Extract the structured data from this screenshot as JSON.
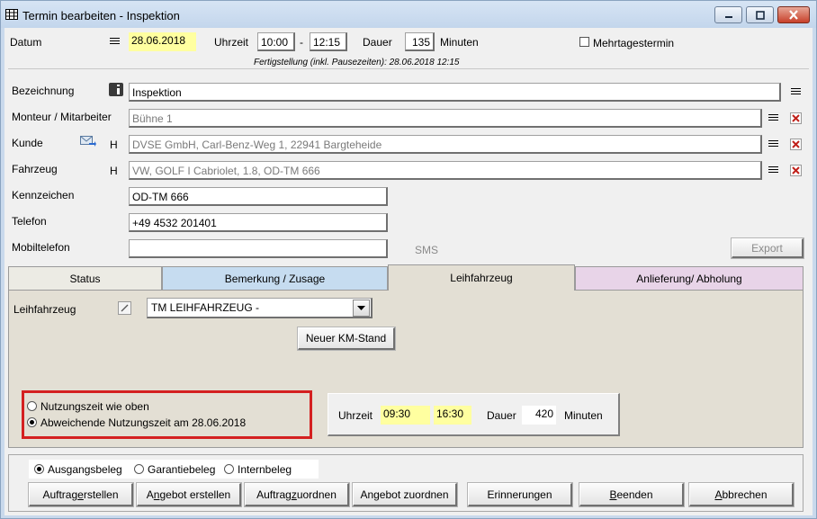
{
  "window": {
    "title": "Termin bearbeiten - Inspektion"
  },
  "header": {
    "datum_label": "Datum",
    "datum_value": "28.06.2018",
    "uhrzeit_label": "Uhrzeit",
    "uhrzeit_from": "10:00",
    "dash": "-",
    "uhrzeit_to": "12:15",
    "dauer_label": "Dauer",
    "dauer_value": "135",
    "minuten_label": "Minuten",
    "mehrtage_label": "Mehrtagestermin",
    "fertigstellung": "Fertigstellung (inkl. Pausezeiten): 28.06.2018 12:15"
  },
  "fields": {
    "bezeichnung_label": "Bezeichnung",
    "bezeichnung_value": "Inspektion",
    "monteur_label": "Monteur / Mitarbeiter",
    "monteur_value": "Bühne 1",
    "kunde_label": "Kunde",
    "kunde_h": "H",
    "kunde_value": "DVSE GmbH, Carl-Benz-Weg 1, 22941 Bargteheide",
    "fahrzeug_label": "Fahrzeug",
    "fahrzeug_h": "H",
    "fahrzeug_value": "VW, GOLF I Cabriolet, 1.8, OD-TM 666",
    "kennzeichen_label": "Kennzeichen",
    "kennzeichen_value": "OD-TM 666",
    "telefon_label": "Telefon",
    "telefon_value": "+49 4532 201401",
    "mobil_label": "Mobiltelefon",
    "mobil_value": "",
    "sms_label": "SMS",
    "export_label": "Export"
  },
  "tabs": [
    {
      "label": "Status"
    },
    {
      "label": "Bemerkung / Zusage"
    },
    {
      "label": "Leihfahrzeug"
    },
    {
      "label": "Anlieferung/ Abholung"
    }
  ],
  "leih": {
    "label": "Leihfahrzeug",
    "selected": "TM LEIHFAHRZEUG -",
    "km_button": "Neuer KM-Stand",
    "radio_1": "Nutzungszeit wie oben",
    "radio_2": "Abweichende Nutzungszeit am 28.06.2018",
    "uhrzeit_label": "Uhrzeit",
    "from": "09:30",
    "to": "16:30",
    "dauer_label": "Dauer",
    "dauer_value": "420",
    "minuten_label": "Minuten"
  },
  "beleg": {
    "ausgang": "Ausgangsbeleg",
    "garantie": "Garantiebeleg",
    "intern": "Internbeleg"
  },
  "buttons": {
    "auftrag_erstellen_a": "Auftrag ",
    "auftrag_erstellen_b": "e",
    "auftrag_erstellen_c": "rstellen",
    "angebot_erstellen_a": "A",
    "angebot_erstellen_b": "n",
    "angebot_erstellen_c": "gebot erstellen",
    "auftrag_zuordnen_a": "Auftrag ",
    "auftrag_zuordnen_b": "z",
    "auftrag_zuordnen_c": "uordnen",
    "angebot_zuordnen": "Angebot zuordnen",
    "erinnerungen": "Erinnerungen",
    "beenden_a": "B",
    "beenden_b": "eenden",
    "abbrechen_a": "A",
    "abbrechen_b": "bbrechen"
  },
  "colors": {
    "highlight_yellow": "#ffffa0",
    "tab_blue": "#c6dcf0",
    "tab_pink": "#e8d4e8",
    "panel_beige": "#e3dfd4",
    "annotation_red": "#d42020"
  }
}
